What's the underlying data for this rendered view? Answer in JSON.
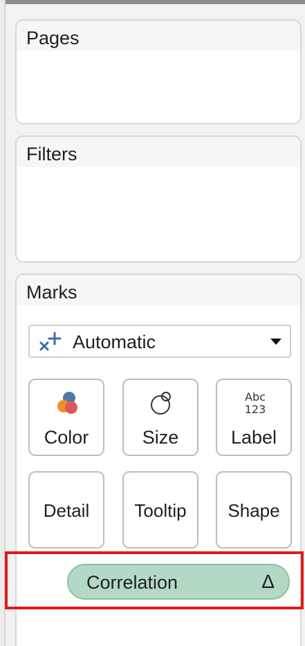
{
  "pages": {
    "title": "Pages"
  },
  "filters": {
    "title": "Filters"
  },
  "marks": {
    "title": "Marks",
    "mark_type": {
      "icon": "automatic-mark-icon",
      "value": "Automatic"
    },
    "buttons": {
      "color": {
        "label": "Color",
        "icon": "color-icon"
      },
      "size": {
        "label": "Size",
        "icon": "size-icon"
      },
      "label": {
        "label": "Label",
        "icon": "label-text-icon",
        "icon_text_top": "Abc",
        "icon_text_bottom": "123"
      },
      "detail": {
        "label": "Detail"
      },
      "tooltip": {
        "label": "Tooltip"
      },
      "shape": {
        "label": "Shape"
      }
    },
    "field_pill": {
      "label": "Correlation",
      "indicator": "Δ",
      "color": "#b3d9c4"
    }
  },
  "annotation": {
    "highlight_color": "#e0191c"
  }
}
